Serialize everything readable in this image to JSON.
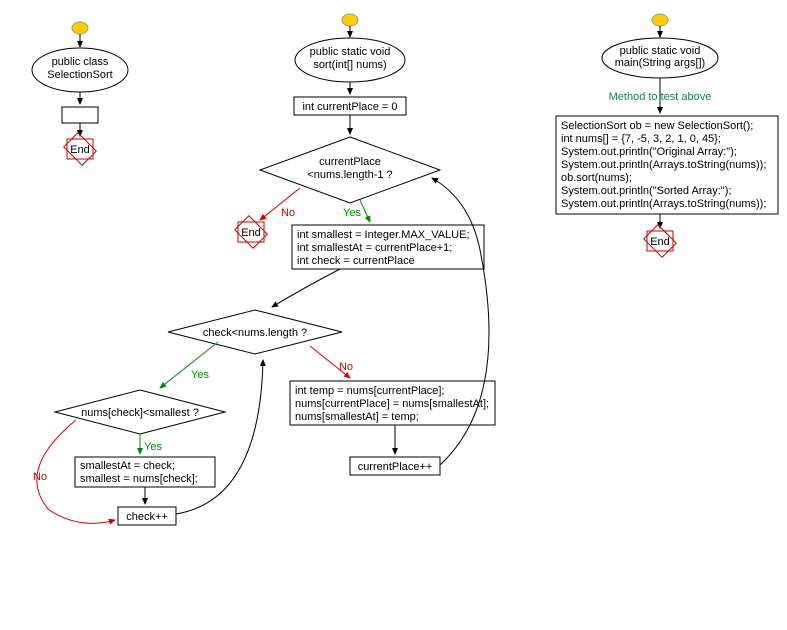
{
  "left": {
    "title1": "public class",
    "title2": "SelectionSort",
    "end": "End"
  },
  "mid": {
    "title1": "public static void",
    "title2": "sort(int[] nums)",
    "init": "int currentPlace = 0",
    "loop1a": "currentPlace",
    "loop1b": "<nums.length-1 ?",
    "body1a": "int smallest = Integer.MAX_VALUE;",
    "body1b": "int smallestAt = currentPlace+1;",
    "body1c": "int check = currentPlace",
    "loop2": "check<nums.length ?",
    "cond": "nums[check]<smallest ?",
    "assign1": "smallestAt = check;",
    "assign2": "smallest = nums[check];",
    "inc2": "check++",
    "swap1": "int temp = nums[currentPlace];",
    "swap2": "nums[currentPlace] = nums[smallestAt];",
    "swap3": "nums[smallestAt] = temp;",
    "inc1": "currentPlace++",
    "end1": "End",
    "end2": "End",
    "yes": "Yes",
    "no": "No"
  },
  "right": {
    "title1": "public static void",
    "title2": "main(String args[])",
    "comment": "Method to test above",
    "b1": "SelectionSort ob = new SelectionSort();",
    "b2": "int nums[] = {7, -5, 3, 2, 1, 0, 45};",
    "b3": "System.out.println(\"Original  Array:\");",
    "b4": "System.out.println(Arrays.toString(nums));",
    "b5": "ob.sort(nums);",
    "b6": "System.out.println(\"Sorted  Array:\");",
    "b7": "System.out.println(Arrays.toString(nums));",
    "end": "End"
  }
}
